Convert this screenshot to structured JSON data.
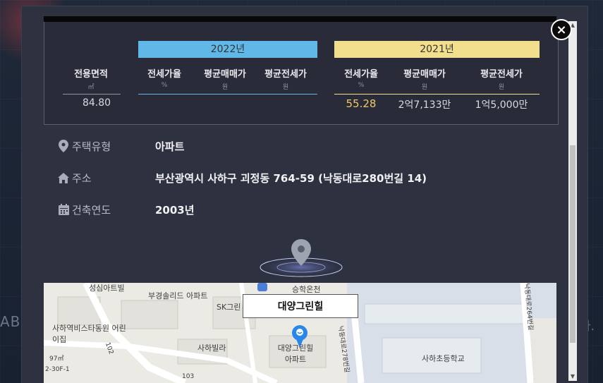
{
  "background": {
    "left_text": "ABC",
    "right_text": "다."
  },
  "stats": {
    "area_header": {
      "label": "전용면적",
      "unit": "㎡",
      "value": "84.80"
    },
    "years": [
      {
        "label": "2022년",
        "color": "#5fb8e8",
        "columns": [
          {
            "label": "전세가율",
            "unit": "%",
            "value": ""
          },
          {
            "label": "평균매매가",
            "unit": "원",
            "value": ""
          },
          {
            "label": "평균전세가",
            "unit": "원",
            "value": ""
          }
        ]
      },
      {
        "label": "2021년",
        "color": "#f1df8e",
        "columns": [
          {
            "label": "전세가율",
            "unit": "%",
            "value": "55.28"
          },
          {
            "label": "평균매매가",
            "unit": "원",
            "value": "2억7,133만"
          },
          {
            "label": "평균전세가",
            "unit": "원",
            "value": "1억5,000만"
          }
        ]
      }
    ]
  },
  "info": [
    {
      "icon": "location-pin-icon",
      "label": "주택유형",
      "value": "아파트"
    },
    {
      "icon": "house-icon",
      "label": "주소",
      "value": "부산광역시 사하구 괴정동 764-59 (낙동대로280번길 14)"
    },
    {
      "icon": "calendar-icon",
      "label": "건축연도",
      "value": "2003년"
    }
  ],
  "map": {
    "callout": "대양그린힐",
    "labels": [
      "성심아트빌",
      "부경솔리드 아파트",
      "SK그린 오피스텔",
      "승학온천",
      "사하역비스타동원 어린이집",
      "사하빌라",
      "대양그린힐 아파트",
      "사하초등학교",
      "낙동대로278번길",
      "낙동대로264번길",
      "97㎡",
      "102",
      "103",
      "2-30F-1"
    ]
  },
  "ui": {
    "close": "×",
    "scroll_up": "▲",
    "scroll_down": "▼"
  }
}
